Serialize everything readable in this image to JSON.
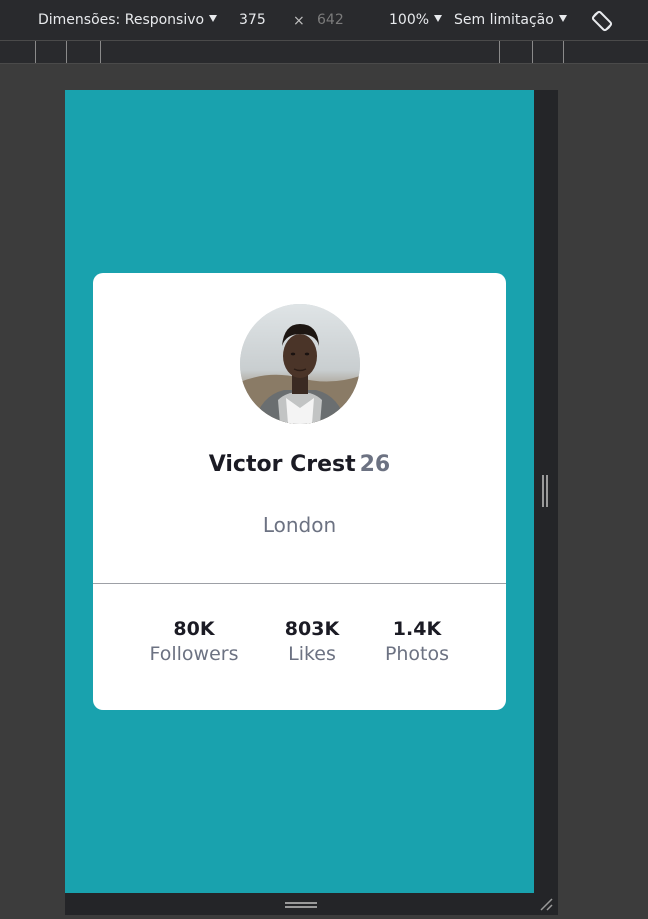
{
  "devtools": {
    "dimensions_label": "Dimensões: Responsivo",
    "width_value": "375",
    "times_symbol": "×",
    "height_value": "642",
    "zoom_label": "100%",
    "throttle_label": "Sem limitação",
    "rotate_icon": "rotate-icon"
  },
  "profile": {
    "name": "Victor Crest",
    "age": "26",
    "location": "London",
    "stats": [
      {
        "value": "80K",
        "label": "Followers"
      },
      {
        "value": "803K",
        "label": "Likes"
      },
      {
        "value": "1.4K",
        "label": "Photos"
      }
    ]
  },
  "colors": {
    "background": "#19a2ae",
    "card": "#ffffff",
    "text_dark": "#1b1b24",
    "text_muted": "#6c7282"
  }
}
